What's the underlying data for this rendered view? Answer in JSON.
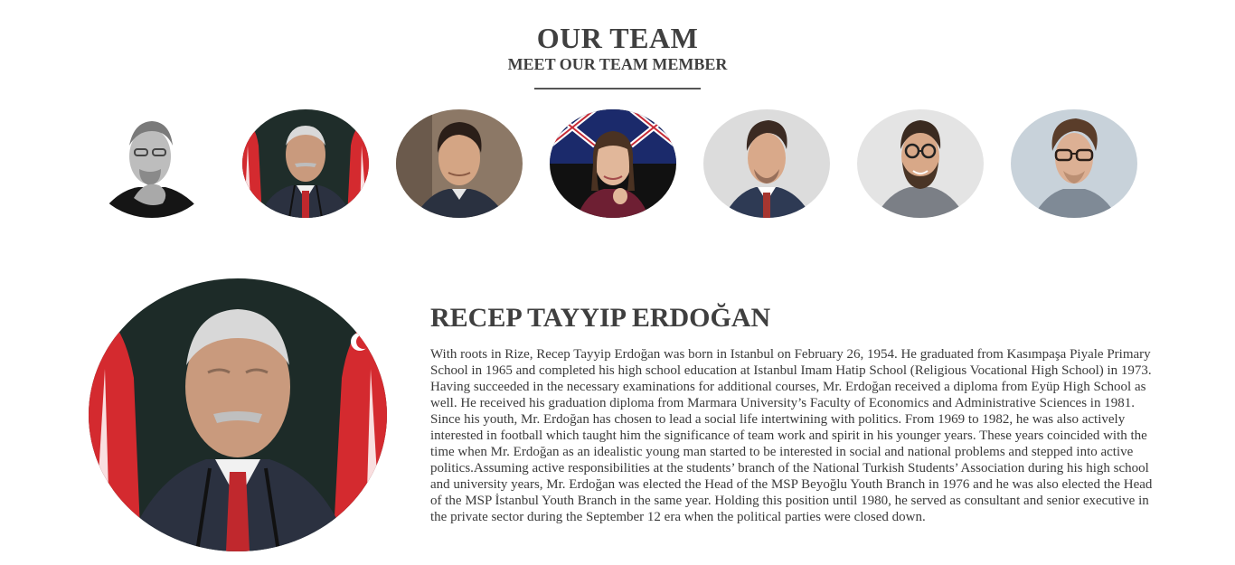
{
  "header": {
    "title": "OUR TEAM",
    "subtitle": "MEET OUR TEAM MEMBER"
  },
  "team": [
    {
      "photo": "portrait-black-and-white-man-hand-on-chin-icon"
    },
    {
      "photo": "portrait-older-man-flags-icon"
    },
    {
      "photo": "portrait-man-dark-hair-icon"
    },
    {
      "photo": "portrait-woman-flag-background-icon"
    },
    {
      "photo": "portrait-young-man-suit-icon"
    },
    {
      "photo": "portrait-bearded-man-glasses-icon"
    },
    {
      "photo": "portrait-man-glasses-icon"
    }
  ],
  "selected": {
    "name": "RECEP TAYYIP ERDOĞAN",
    "bio_paragraph_1": "With roots in Rize, Recep Tayyip Erdoğan was born in Istanbul on February 26, 1954. He graduated from Kasımpaşa Piyale Primary School in 1965 and completed his high school education at Istanbul Imam Hatip School (Religious Vocational High School) in 1973. Having succeeded in the necessary examinations for additional courses, Mr. Erdoğan received a diploma from Eyüp High School as well. He received his graduation diploma from Marmara University’s Faculty of Economics and Administrative Sciences in 1981.",
    "bio_paragraph_2": "Since his youth, Mr. Erdoğan has chosen to lead a social life intertwining with politics. From 1969 to 1982, he was also actively interested in football which taught him the significance of team work and spirit in his younger years. These years coincided with the time when Mr. Erdoğan as an idealistic young man started to be interested in social and national problems and stepped into active politics.Assuming active responsibilities at the students’ branch of the National Turkish Students’ Association during his high school and university years, Mr. Erdoğan was elected the Head of the MSP Beyoğlu Youth Branch in 1976 and he was also elected the Head of the MSP İstanbul Youth Branch in the same year. Holding this position until 1980, he served as consultant and senior executive in the private sector during the September 12 era when the political parties were closed down.",
    "photo": "portrait-older-man-flags-icon"
  },
  "colors": {
    "heading": "#404040",
    "body_text": "#3a3a3a",
    "rule": "#555555",
    "flag_red": "#d42a2f"
  }
}
